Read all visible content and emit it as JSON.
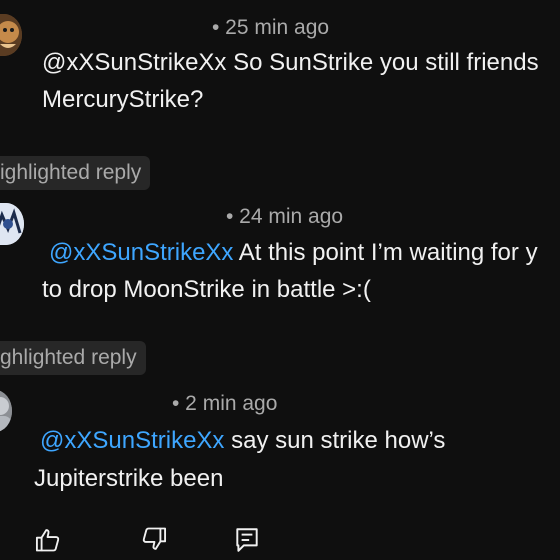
{
  "replies": [
    {
      "time": "• 25 min ago",
      "mention": "@xXSunStrikeXx",
      "line1": " So SunStrike you still friends",
      "line2": "MercuryStrike?"
    },
    {
      "time": "• 24 min ago",
      "mention": "@xXSunStrikeXx",
      "line1": " At this point I’m waiting for y",
      "line2": "to drop MoonStrike in battle >:("
    },
    {
      "time": "• 2 min ago",
      "mention": "@xXSunStrikeXx",
      "line1": " say sun strike how’s",
      "line2": "Jupiterstrike been"
    }
  ],
  "badges": {
    "first": "ighlighted reply",
    "second": "ghlighted reply"
  },
  "actions": {
    "like_icon": "thumbs-up-icon",
    "dislike_icon": "thumbs-down-icon",
    "reply_icon": "comment-icon"
  },
  "colors": {
    "background": "#0f0f0f",
    "text": "#f1f1f1",
    "secondary": "#aaaaaa",
    "mention": "#3ea6ff",
    "badge_bg": "#272727"
  }
}
